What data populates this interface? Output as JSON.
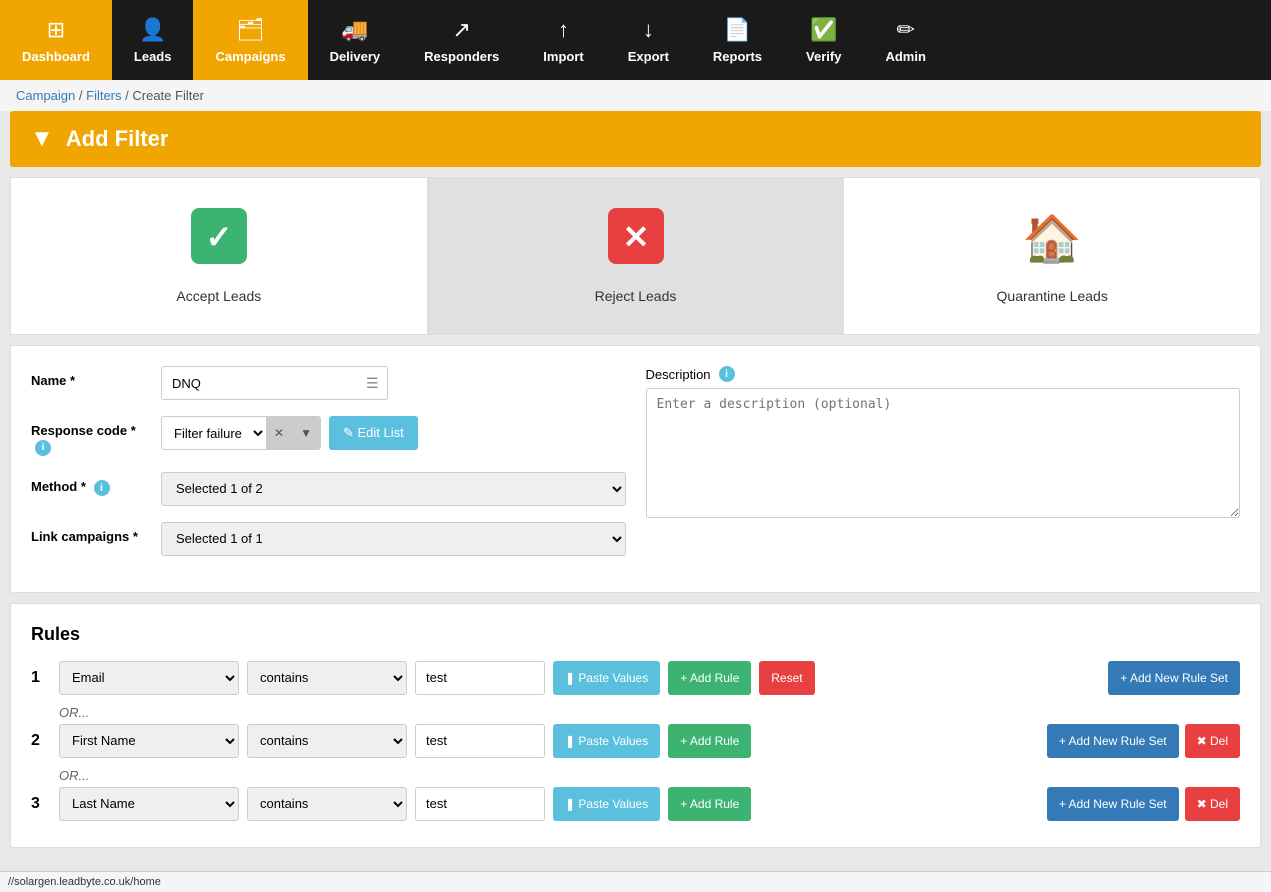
{
  "navbar": {
    "items": [
      {
        "id": "dashboard",
        "label": "Dashboard",
        "icon": "⊞",
        "active": false
      },
      {
        "id": "leads",
        "label": "Leads",
        "icon": "👤",
        "active": false
      },
      {
        "id": "campaigns",
        "label": "Campaigns",
        "icon": "🗂",
        "active": true
      },
      {
        "id": "delivery",
        "label": "Delivery",
        "icon": "🚚",
        "active": false
      },
      {
        "id": "responders",
        "label": "Responders",
        "icon": "📨",
        "active": false
      },
      {
        "id": "import",
        "label": "Import",
        "icon": "⬆",
        "active": false
      },
      {
        "id": "export",
        "label": "Export",
        "icon": "⬇",
        "active": false
      },
      {
        "id": "reports",
        "label": "Reports",
        "icon": "📄",
        "active": false
      },
      {
        "id": "verify",
        "label": "Verify",
        "icon": "✅",
        "active": false
      },
      {
        "id": "admin",
        "label": "Admin",
        "icon": "✏",
        "active": false
      }
    ]
  },
  "breadcrumb": {
    "parts": [
      "Campaign",
      "Filters",
      "Create Filter"
    ]
  },
  "page_header": {
    "title": "Add Filter",
    "icon": "▼"
  },
  "filter_cards": [
    {
      "id": "accept",
      "label": "Accept Leads",
      "icon": "✔",
      "selected": false
    },
    {
      "id": "reject",
      "label": "Reject Leads",
      "icon": "✖",
      "selected": true
    },
    {
      "id": "quarantine",
      "label": "Quarantine Leads",
      "icon": "🏠",
      "selected": false
    }
  ],
  "form": {
    "name_label": "Name *",
    "name_value": "DNQ",
    "response_code_label": "Response code *",
    "response_code_value": "Filter failure",
    "edit_list_btn": "✎ Edit List",
    "method_label": "Method *",
    "method_value": "Selected 1 of 2",
    "link_campaigns_label": "Link campaigns *",
    "link_campaigns_value": "Selected 1 of 1",
    "description_label": "Description",
    "description_placeholder": "Enter a description (optional)"
  },
  "rules": {
    "title": "Rules",
    "rows": [
      {
        "number": "1",
        "field": "Email",
        "condition": "contains",
        "value": "test",
        "show_del": false,
        "show_reset": true,
        "add_ruleset_label": "+ Add New Rule Set",
        "paste_label": "❚ Paste Values",
        "add_rule_label": "+ Add Rule",
        "reset_label": "Reset"
      },
      {
        "number": "2",
        "field": "First Name",
        "condition": "contains",
        "value": "test",
        "show_del": true,
        "show_reset": false,
        "add_ruleset_label": "+ Add New Rule Set",
        "paste_label": "❚ Paste Values",
        "add_rule_label": "+ Add Rule",
        "del_label": "✖ Del"
      },
      {
        "number": "3",
        "field": "Last Name",
        "condition": "contains",
        "value": "test",
        "show_del": true,
        "show_reset": false,
        "add_ruleset_label": "+ Add New Rule Set",
        "paste_label": "❚ Paste Values",
        "add_rule_label": "+ Add Rule",
        "del_label": "✖ Del"
      }
    ],
    "or_label": "OR..."
  },
  "status_bar": {
    "url": "//solargen.leadbyte.co.uk/home"
  }
}
